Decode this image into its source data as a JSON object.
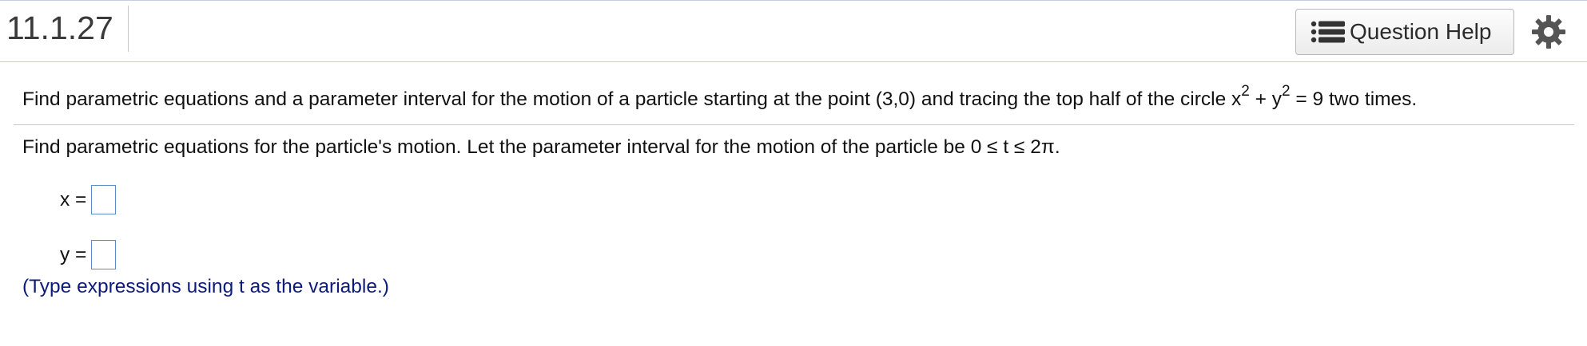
{
  "header": {
    "question_number": "11.1.27",
    "help_button_label": "Question Help"
  },
  "question": {
    "prompt_part1": "Find parametric equations and a parameter interval for the motion of a particle starting at the point (3,0) and tracing the top half of the circle x",
    "prompt_sup1": "2",
    "prompt_part2": " + y",
    "prompt_sup2": "2",
    "prompt_part3": " = 9 two times.",
    "instruction": "Find parametric equations for the particle's motion. Let the parameter interval for the motion of the particle be 0 ≤ t ≤ 2π.",
    "x_label": "x =",
    "y_label": "y =",
    "hint": "(Type expressions using t as the variable.)"
  },
  "icons": {
    "help": "list-icon",
    "settings": "gear-icon"
  },
  "colors": {
    "hint_text": "#0c1a7a",
    "answer_box_border": "#5b8ac9",
    "header_border": "#c8cde6"
  }
}
